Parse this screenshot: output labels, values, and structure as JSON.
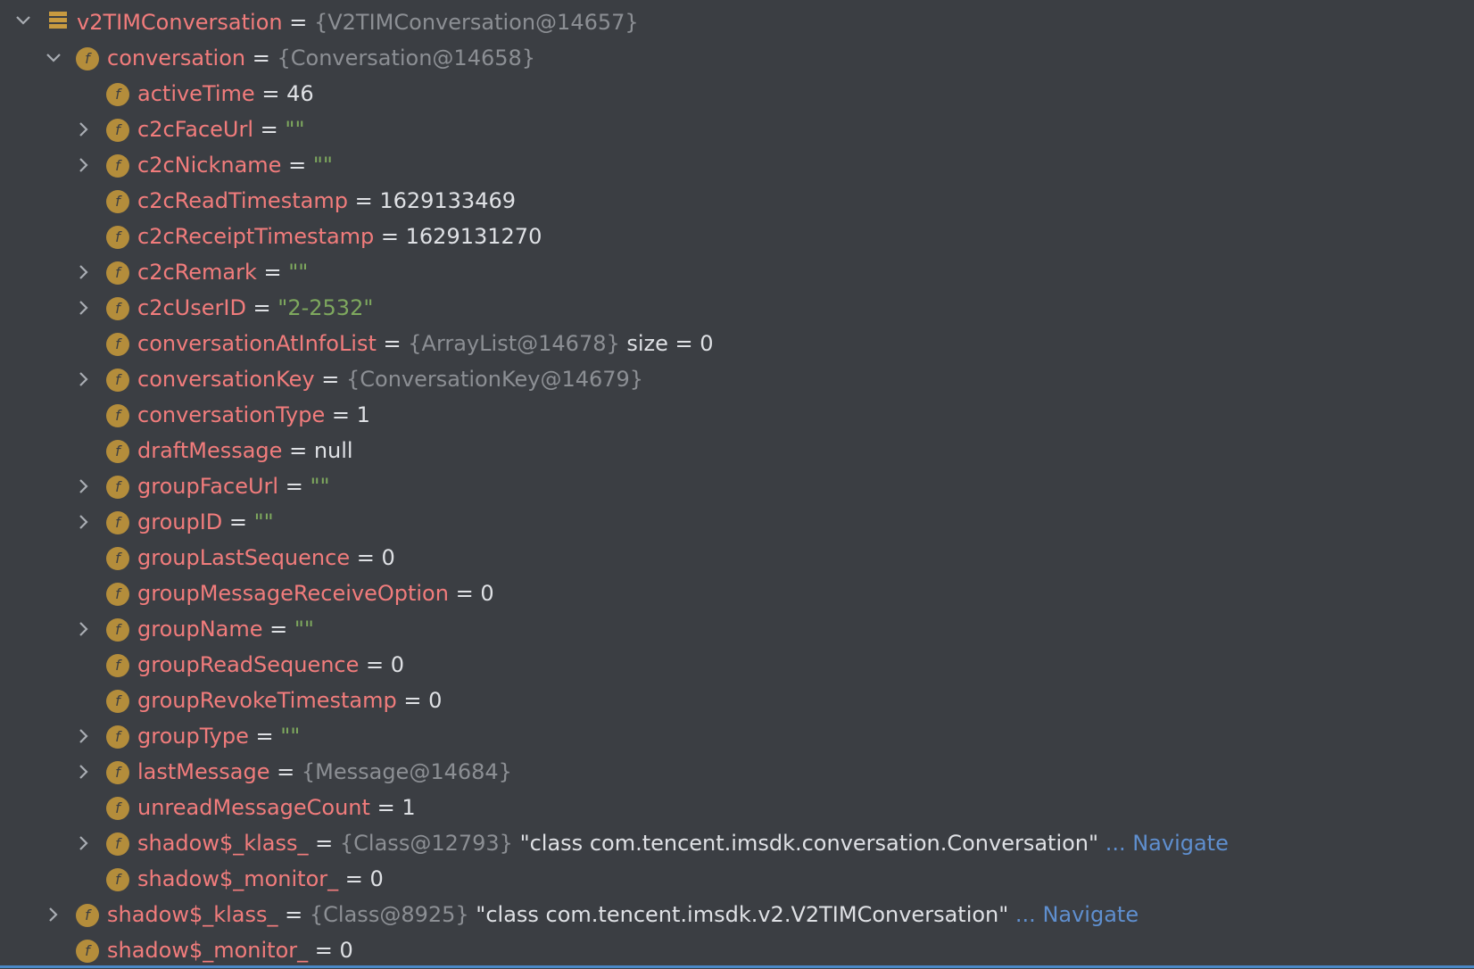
{
  "root": {
    "name": "v2TIMConversation",
    "eq": " = ",
    "ref": "{V2TIMConversation@14657}"
  },
  "conversation": {
    "name": "conversation",
    "eq": " = ",
    "ref": "{Conversation@14658}"
  },
  "fields": [
    {
      "name": "activeTime",
      "eq": " = ",
      "val": "46"
    },
    {
      "name": "c2cFaceUrl",
      "eq": " = ",
      "str": "\"\""
    },
    {
      "name": "c2cNickname",
      "eq": " = ",
      "str": "\"\""
    },
    {
      "name": "c2cReadTimestamp",
      "eq": " = ",
      "val": "1629133469"
    },
    {
      "name": "c2cReceiptTimestamp",
      "eq": " = ",
      "val": "1629131270"
    },
    {
      "name": "c2cRemark",
      "eq": " = ",
      "str": "\"\""
    },
    {
      "name": "c2cUserID",
      "eq": " = ",
      "str": "\"2-2532\""
    },
    {
      "name": "conversationAtInfoList",
      "eq": " = ",
      "ref": "{ArrayList@14678}",
      "val": "  size = 0"
    },
    {
      "name": "conversationKey",
      "eq": " = ",
      "ref": "{ConversationKey@14679}"
    },
    {
      "name": "conversationType",
      "eq": " = ",
      "val": "1"
    },
    {
      "name": "draftMessage",
      "eq": " = ",
      "val": "null"
    },
    {
      "name": "groupFaceUrl",
      "eq": " = ",
      "str": "\"\""
    },
    {
      "name": "groupID",
      "eq": " = ",
      "str": "\"\""
    },
    {
      "name": "groupLastSequence",
      "eq": " = ",
      "val": "0"
    },
    {
      "name": "groupMessageReceiveOption",
      "eq": " = ",
      "val": "0"
    },
    {
      "name": "groupName",
      "eq": " = ",
      "str": "\"\""
    },
    {
      "name": "groupReadSequence",
      "eq": " = ",
      "val": "0"
    },
    {
      "name": "groupRevokeTimestamp",
      "eq": " = ",
      "val": "0"
    },
    {
      "name": "groupType",
      "eq": " = ",
      "str": "\"\""
    },
    {
      "name": "lastMessage",
      "eq": " = ",
      "ref": "{Message@14684}"
    },
    {
      "name": "unreadMessageCount",
      "eq": " = ",
      "val": "1"
    },
    {
      "name": "shadow$_klass_",
      "eq": " = ",
      "ref": "{Class@12793}",
      "val": " \"class com.tencent.imsdk.conversation.Conversation\"",
      "nav": " ... Navigate"
    },
    {
      "name": "shadow$_monitor_",
      "eq": " = ",
      "val": "0"
    }
  ],
  "outer_fields": [
    {
      "name": "shadow$_klass_",
      "eq": " = ",
      "ref": "{Class@8925}",
      "val": " \"class com.tencent.imsdk.v2.V2TIMConversation\"",
      "nav": " ... Navigate"
    },
    {
      "name": "shadow$_monitor_",
      "eq": " = ",
      "val": "0"
    }
  ],
  "field_icon_letter": "f",
  "icons": {
    "expanded": "chevron-down-icon",
    "collapsed": "chevron-right-icon",
    "field": "field-icon",
    "object": "stack-icon"
  },
  "colors": {
    "background": "#3b3e43",
    "name": "#f17c7c",
    "reference": "#8c8f94",
    "string": "#7ea85e",
    "link": "#5f8fcf",
    "field_icon": "#b48d3b"
  }
}
